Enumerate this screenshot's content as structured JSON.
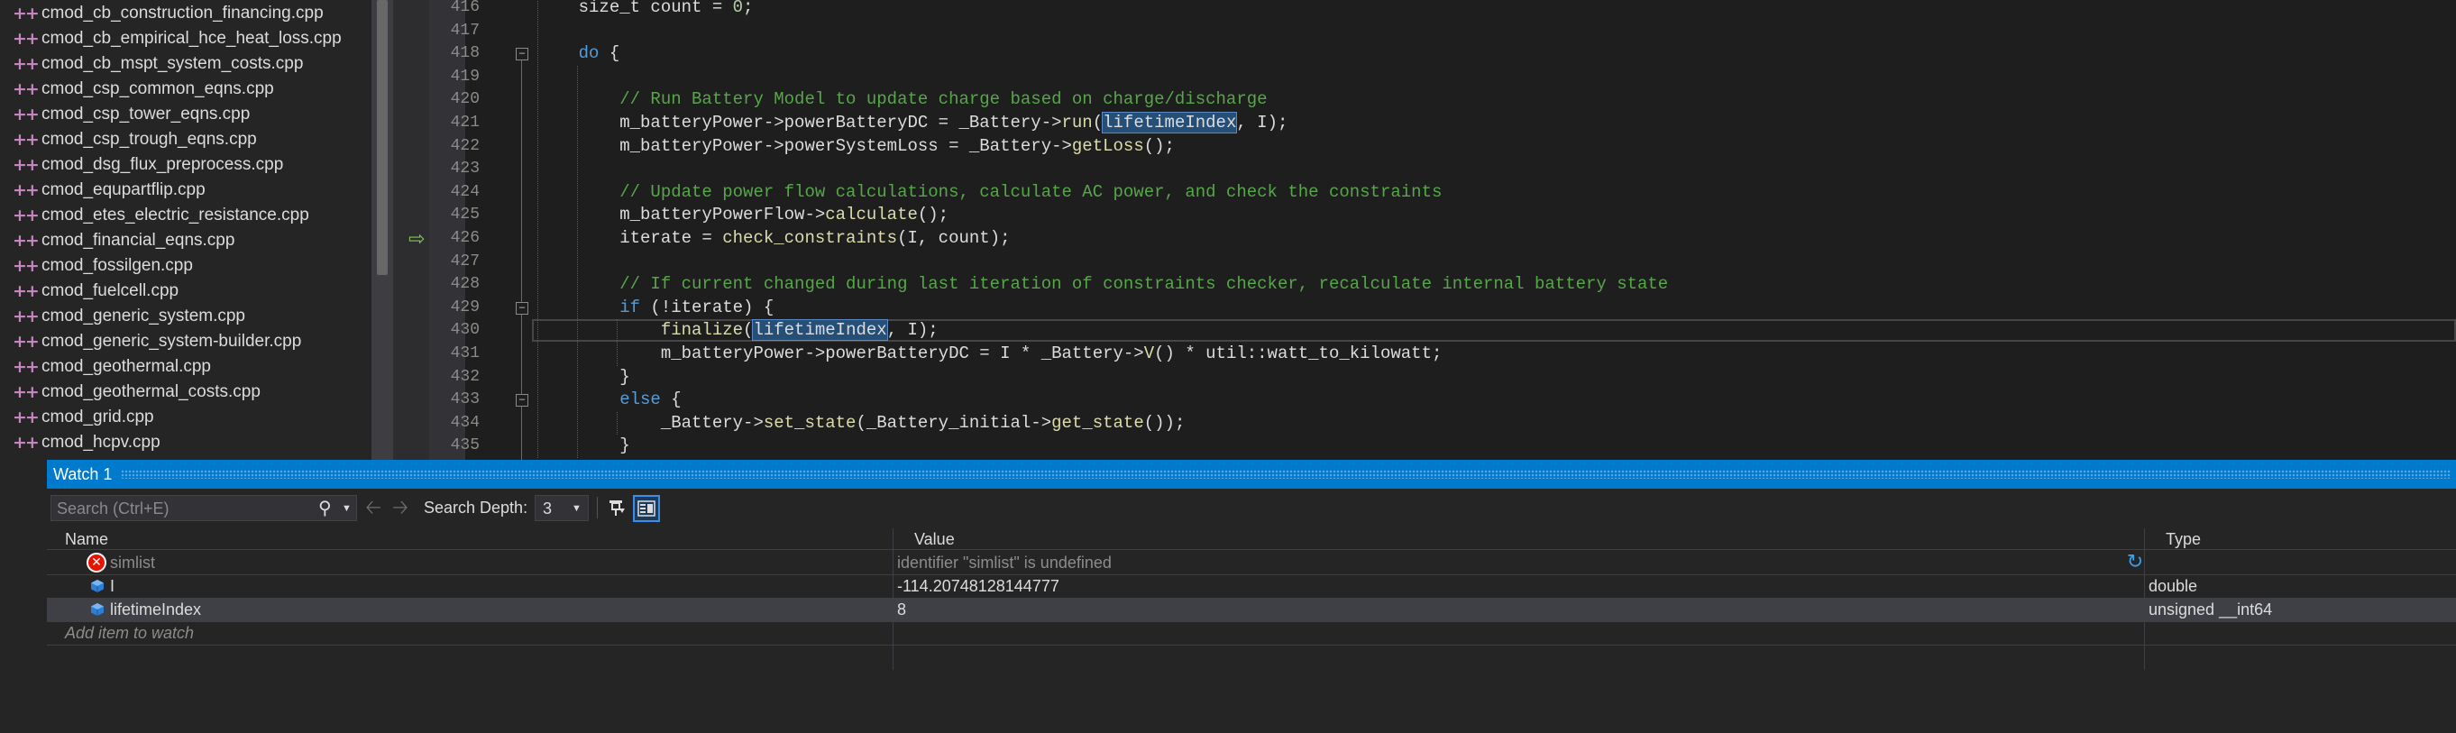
{
  "solution_explorer": {
    "files": [
      "cmod_cb_construction_financing.cpp",
      "cmod_cb_empirical_hce_heat_loss.cpp",
      "cmod_cb_mspt_system_costs.cpp",
      "cmod_csp_common_eqns.cpp",
      "cmod_csp_tower_eqns.cpp",
      "cmod_csp_trough_eqns.cpp",
      "cmod_dsg_flux_preprocess.cpp",
      "cmod_equpartflip.cpp",
      "cmod_etes_electric_resistance.cpp",
      "cmod_financial_eqns.cpp",
      "cmod_fossilgen.cpp",
      "cmod_fuelcell.cpp",
      "cmod_generic_system.cpp",
      "cmod_generic_system-builder.cpp",
      "cmod_geothermal.cpp",
      "cmod_geothermal_costs.cpp",
      "cmod_grid.cpp",
      "cmod_hcpv.cpp"
    ],
    "partial_row_letter": "c"
  },
  "editor": {
    "lines": [
      {
        "num": "416",
        "segs": [
          [
            "plain",
            "    size_t count = "
          ],
          [
            "num",
            "0"
          ],
          [
            "plain",
            ";"
          ]
        ]
      },
      {
        "num": "417",
        "segs": []
      },
      {
        "num": "418",
        "segs": [
          [
            "plain",
            "    "
          ],
          [
            "kw",
            "do"
          ],
          [
            "plain",
            " {"
          ]
        ]
      },
      {
        "num": "419",
        "segs": []
      },
      {
        "num": "420",
        "segs": [
          [
            "plain",
            "        "
          ],
          [
            "cm",
            "// Run Battery Model to update charge based on charge/discharge"
          ]
        ]
      },
      {
        "num": "421",
        "segs": [
          [
            "plain",
            "        m_batteryPower->powerBatteryDC = _Battery->"
          ],
          [
            "fn",
            "run"
          ],
          [
            "plain",
            "("
          ],
          [
            "hl",
            "lifetimeIndex"
          ],
          [
            "plain",
            ", I);"
          ]
        ]
      },
      {
        "num": "422",
        "segs": [
          [
            "plain",
            "        m_batteryPower->powerSystemLoss = _Battery->"
          ],
          [
            "fn",
            "getLoss"
          ],
          [
            "plain",
            "();"
          ]
        ]
      },
      {
        "num": "423",
        "segs": []
      },
      {
        "num": "424",
        "segs": [
          [
            "plain",
            "        "
          ],
          [
            "cm",
            "// Update power flow calculations, calculate AC power, and check the constraints"
          ]
        ]
      },
      {
        "num": "425",
        "segs": [
          [
            "plain",
            "        m_batteryPowerFlow->"
          ],
          [
            "fn",
            "calculate"
          ],
          [
            "plain",
            "();"
          ]
        ]
      },
      {
        "num": "426",
        "segs": [
          [
            "plain",
            "        iterate = "
          ],
          [
            "fn",
            "check_constraints"
          ],
          [
            "plain",
            "(I, count);"
          ]
        ]
      },
      {
        "num": "427",
        "segs": []
      },
      {
        "num": "428",
        "segs": [
          [
            "plain",
            "        "
          ],
          [
            "cm",
            "// If current changed during last iteration of constraints checker, recalculate internal battery state"
          ]
        ]
      },
      {
        "num": "429",
        "segs": [
          [
            "plain",
            "        "
          ],
          [
            "kw",
            "if"
          ],
          [
            "plain",
            " (!iterate) {"
          ]
        ]
      },
      {
        "num": "430",
        "segs": [
          [
            "plain",
            "            "
          ],
          [
            "fn",
            "finalize"
          ],
          [
            "plain",
            "("
          ],
          [
            "hl",
            "lifetimeIndex"
          ],
          [
            "plain",
            ", I);"
          ]
        ]
      },
      {
        "num": "431",
        "segs": [
          [
            "plain",
            "            m_batteryPower->powerBatteryDC = I * _Battery->"
          ],
          [
            "fn",
            "V"
          ],
          [
            "plain",
            "() * util::watt_to_kilowatt;"
          ]
        ]
      },
      {
        "num": "432",
        "segs": [
          [
            "plain",
            "        }"
          ]
        ]
      },
      {
        "num": "433",
        "segs": [
          [
            "plain",
            "        "
          ],
          [
            "kw",
            "else"
          ],
          [
            "plain",
            " {"
          ]
        ]
      },
      {
        "num": "434",
        "segs": [
          [
            "plain",
            "            _Battery->"
          ],
          [
            "fn",
            "set_state"
          ],
          [
            "plain",
            "(_Battery_initial->"
          ],
          [
            "fn",
            "get_state"
          ],
          [
            "plain",
            "());"
          ]
        ]
      },
      {
        "num": "435",
        "segs": [
          [
            "plain",
            "        }"
          ]
        ]
      }
    ],
    "colors": {
      "keyword": "#569cd6",
      "comment": "#57a64a",
      "number": "#b5cea8",
      "function": "#dcdcaa",
      "highlight": "#264f78"
    }
  },
  "watch": {
    "title": "Watch 1",
    "search_placeholder": "Search (Ctrl+E)",
    "search_depth_label": "Search Depth:",
    "search_depth_value": "3",
    "columns": {
      "name": "Name",
      "value": "Value",
      "type": "Type"
    },
    "rows": [
      {
        "name": "simlist",
        "value": "identifier \"simlist\" is undefined",
        "type": "",
        "icon": "error-icon",
        "error": true
      },
      {
        "name": "I",
        "value": "-114.20748128144777",
        "type": "double",
        "icon": "variable-icon",
        "error": false
      },
      {
        "name": "lifetimeIndex",
        "value": "8",
        "type": "unsigned __int64",
        "icon": "variable-icon",
        "error": false
      }
    ],
    "add_item_text": "Add item to watch",
    "accent_color": "#007acc"
  }
}
